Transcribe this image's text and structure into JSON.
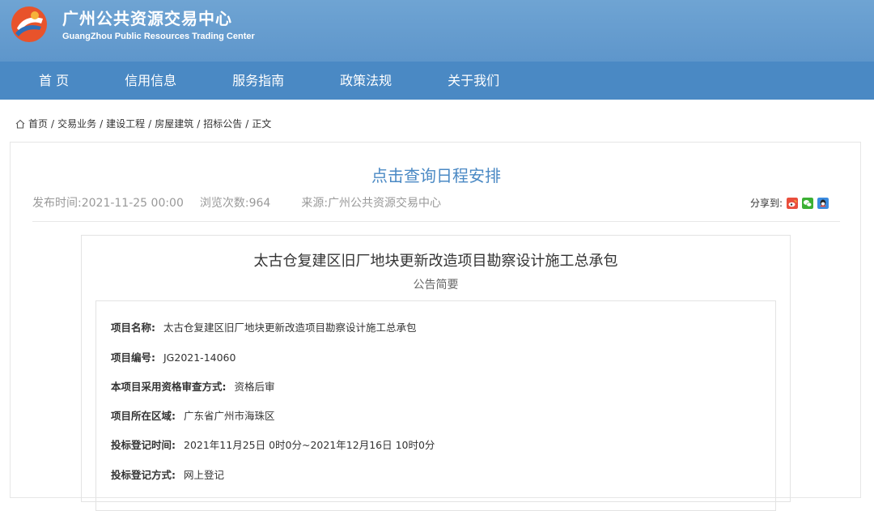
{
  "header": {
    "title_cn": "广州公共资源交易中心",
    "title_en": "GuangZhou Public Resources Trading Center",
    "logo_icon": "logo-icon"
  },
  "nav": {
    "items": [
      "首 页",
      "信用信息",
      "服务指南",
      "政策法规",
      "关于我们"
    ]
  },
  "breadcrumb": {
    "icon": "home-icon",
    "items": [
      "首页",
      "交易业务",
      "建设工程",
      "房屋建筑",
      "招标公告",
      "正文"
    ],
    "separator": "/"
  },
  "article": {
    "title": "点击查询日程安排",
    "publish_label": "发布时间:",
    "publish_value": "2021-11-25 00:00",
    "views_label": "浏览次数:",
    "views_value": "964",
    "source_label": "来源:",
    "source_value": "广州公共资源交易中心",
    "share_label": "分享到:",
    "share_icons": [
      "weibo-icon",
      "wechat-icon",
      "qq-icon"
    ]
  },
  "document": {
    "title": "太古仓复建区旧厂地块更新改造项目勘察设计施工总承包",
    "subtitle": "公告简要",
    "fields": [
      {
        "key": "项目名称:",
        "value": "太古仓复建区旧厂地块更新改造项目勘察设计施工总承包"
      },
      {
        "key": "项目编号:",
        "value": "JG2021-14060"
      },
      {
        "key": "本项目采用资格审查方式:",
        "value": "资格后审"
      },
      {
        "key": "项目所在区域:",
        "value": "广东省广州市海珠区"
      },
      {
        "key": "投标登记时间:",
        "value": "2021年11月25日 0时0分~2021年12月16日 10时0分"
      },
      {
        "key": "投标登记方式:",
        "value": "网上登记"
      }
    ]
  },
  "colors": {
    "header_bg": "#6fa4d3",
    "nav_bg": "#4a89c4",
    "title_accent": "#4a89c4"
  }
}
